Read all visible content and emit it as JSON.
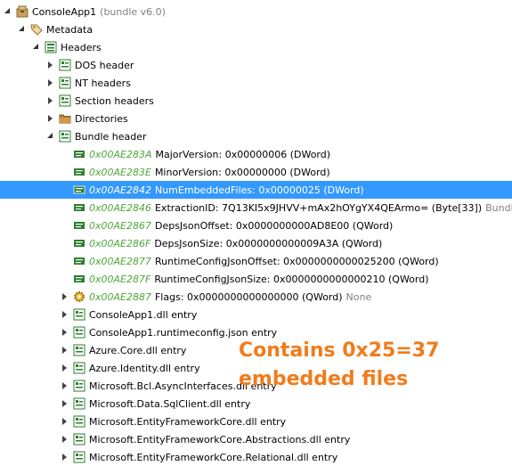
{
  "tree": {
    "root": {
      "label": "ConsoleApp1",
      "suffix": "(bundle v6.0)",
      "icon": "bundle-icon"
    },
    "metadata": {
      "label": "Metadata",
      "icon": "tag-icon"
    },
    "headers": {
      "label": "Headers",
      "icon": "headers-icon"
    },
    "header_groups": [
      {
        "label": "DOS header",
        "icon": "struct-icon"
      },
      {
        "label": "NT headers",
        "icon": "struct-icon"
      },
      {
        "label": "Section headers",
        "icon": "struct-icon"
      },
      {
        "label": "Directories",
        "icon": "folder-icon"
      }
    ],
    "bundle_header": {
      "label": "Bundle header",
      "icon": "struct-icon"
    },
    "fields": [
      {
        "addr": "0x00AE283A",
        "text": "MajorVersion: 0x00000006 (DWord)",
        "extra": ""
      },
      {
        "addr": "0x00AE283E",
        "text": "MinorVersion: 0x00000000 (DWord)",
        "extra": ""
      },
      {
        "addr": "0x00AE2842",
        "text": "NumEmbeddedFiles: 0x00000025 (DWord)",
        "extra": "",
        "selected": true
      },
      {
        "addr": "0x00AE2846",
        "text": "ExtractionID: 7Q13KI5x9JHVV+mAx2hOYgYX4QEArmo= (Byte[33])",
        "extra": "Bundle ID"
      },
      {
        "addr": "0x00AE2867",
        "text": "DepsJsonOffset: 0x0000000000AD8E00 (QWord)",
        "extra": ""
      },
      {
        "addr": "0x00AE286F",
        "text": "DepsJsonSize: 0x0000000000009A3A (QWord)",
        "extra": ""
      },
      {
        "addr": "0x00AE2877",
        "text": "RuntimeConfigJsonOffset: 0x0000000000025200 (QWord)",
        "extra": ""
      },
      {
        "addr": "0x00AE287F",
        "text": "RuntimeConfigJsonSize: 0x0000000000000210 (QWord)",
        "extra": ""
      }
    ],
    "flags": {
      "addr": "0x00AE2887",
      "text": "Flags: 0x0000000000000000 (QWord)",
      "extra": "None",
      "icon": "gear-icon"
    },
    "entries": [
      "ConsoleApp1.dll entry",
      "ConsoleApp1.runtimeconfig.json entry",
      "Azure.Core.dll entry",
      "Azure.Identity.dll entry",
      "Microsoft.Bcl.AsyncInterfaces.dll entry",
      "Microsoft.Data.SqlClient.dll entry",
      "Microsoft.EntityFrameworkCore.dll entry",
      "Microsoft.EntityFrameworkCore.Abstractions.dll entry",
      "Microsoft.EntityFrameworkCore.Relational.dll entry"
    ]
  },
  "annotation": {
    "line1": "Contains 0x25=37",
    "line2": "embedded files",
    "color": "#f07c1c"
  },
  "colors": {
    "address": "#4fa83a",
    "selection": "#3399ff"
  }
}
